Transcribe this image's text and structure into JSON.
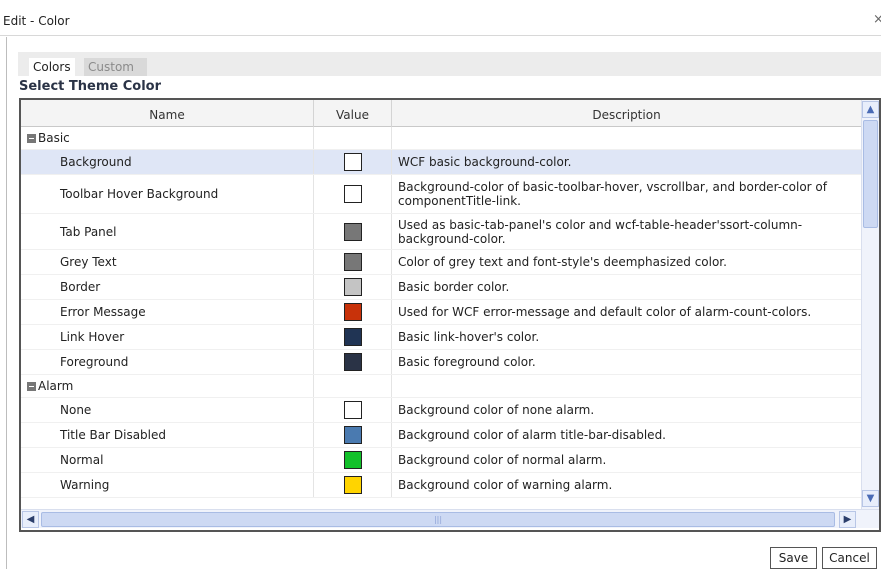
{
  "dialog": {
    "title": "Edit - Color",
    "close_glyph": "×",
    "tabs": [
      {
        "label": "Colors",
        "active": true
      },
      {
        "label": "Custom",
        "active": false
      }
    ],
    "section_title": "Select Theme Color",
    "save_label": "Save",
    "cancel_label": "Cancel"
  },
  "table": {
    "columns": [
      "Name",
      "Value",
      "Description"
    ],
    "groups": [
      {
        "name": "Basic",
        "expanded": true
      },
      {
        "name": "Alarm",
        "expanded": true
      }
    ],
    "rows": [
      {
        "name": "Background",
        "color": "#ffffff",
        "description": "WCF basic background-color.",
        "selected": true
      },
      {
        "name": "Toolbar Hover Background",
        "color": "#ffffff",
        "description": "Background-color of basic-toolbar-hover, vscrollbar, and border-color of componentTitle-link."
      },
      {
        "name": "Tab Panel",
        "color": "#777777",
        "description": "Used as basic-tab-panel's color and wcf-table-header'ssort-column-background-color."
      },
      {
        "name": "Grey Text",
        "color": "#777777",
        "description": "Color of grey text and font-style's deemphasized color."
      },
      {
        "name": "Border",
        "color": "#c4c4c4",
        "description": "Basic border color."
      },
      {
        "name": "Error Message",
        "color": "#c8320a",
        "description": "Used for WCF error-message and default color of alarm-count-colors."
      },
      {
        "name": "Link Hover",
        "color": "#203454",
        "description": "Basic link-hover's color."
      },
      {
        "name": "Foreground",
        "color": "#2a3346",
        "description": "Basic foreground color."
      },
      {
        "name": "None",
        "color": "#ffffff",
        "description": "Background color of none alarm."
      },
      {
        "name": "Title Bar Disabled",
        "color": "#4a7ab0",
        "description": "Background color of alarm title-bar-disabled."
      },
      {
        "name": "Normal",
        "color": "#12c12a",
        "description": "Background color of normal alarm."
      },
      {
        "name": "Warning",
        "color": "#ffd400",
        "description": "Background color of warning alarm."
      }
    ]
  },
  "scrollbars": {
    "vertical": {
      "up_glyph": "▲",
      "down_glyph": "▼"
    },
    "horizontal": {
      "left_glyph": "◀",
      "right_glyph": "▶",
      "grip": "|||"
    }
  }
}
